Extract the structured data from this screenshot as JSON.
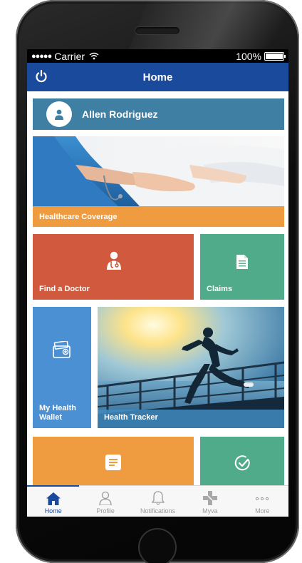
{
  "status_bar": {
    "carrier": "Carrier",
    "battery": "100%"
  },
  "nav": {
    "title": "Home"
  },
  "profile": {
    "name": "Allen Rodriguez"
  },
  "tiles": {
    "coverage": "Healthcare Coverage",
    "doctor": "Find a Doctor",
    "claims": "Claims",
    "wallet": "My Health Wallet",
    "tracker": "Health Tracker"
  },
  "tabs": [
    {
      "label": "Home",
      "icon": "home-icon",
      "active": true
    },
    {
      "label": "Profile",
      "icon": "person-icon",
      "active": false
    },
    {
      "label": "Notifications",
      "icon": "bell-icon",
      "active": false
    },
    {
      "label": "Myva",
      "icon": "medical-cross-icon",
      "active": false
    },
    {
      "label": "More",
      "icon": "more-dots-icon",
      "active": false
    }
  ],
  "colors": {
    "nav_blue": "#1a4a9c",
    "profile_teal": "#3f7fa3",
    "orange": "#ef9b3f",
    "red": "#d15a3e",
    "green": "#4fab8a",
    "blue": "#4b90d3"
  }
}
